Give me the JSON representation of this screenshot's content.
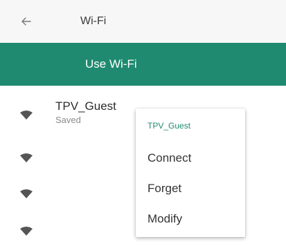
{
  "toolbar": {
    "title": "Wi-Fi",
    "back_icon": "arrow-back-icon"
  },
  "switchbar": {
    "label": "Use Wi-Fi",
    "color": "#1f8a70"
  },
  "networks": [
    {
      "name": "TPV_Guest",
      "status": "Saved",
      "icon": "wifi-signal-icon"
    },
    {
      "name": "",
      "status": "",
      "icon": "wifi-signal-icon"
    },
    {
      "name": "",
      "status": "",
      "icon": "wifi-signal-icon"
    },
    {
      "name": "",
      "status": "",
      "icon": "wifi-signal-icon"
    }
  ],
  "popup": {
    "title": "TPV_Guest",
    "items": [
      {
        "label": "Connect"
      },
      {
        "label": "Forget"
      },
      {
        "label": "Modify"
      }
    ]
  }
}
